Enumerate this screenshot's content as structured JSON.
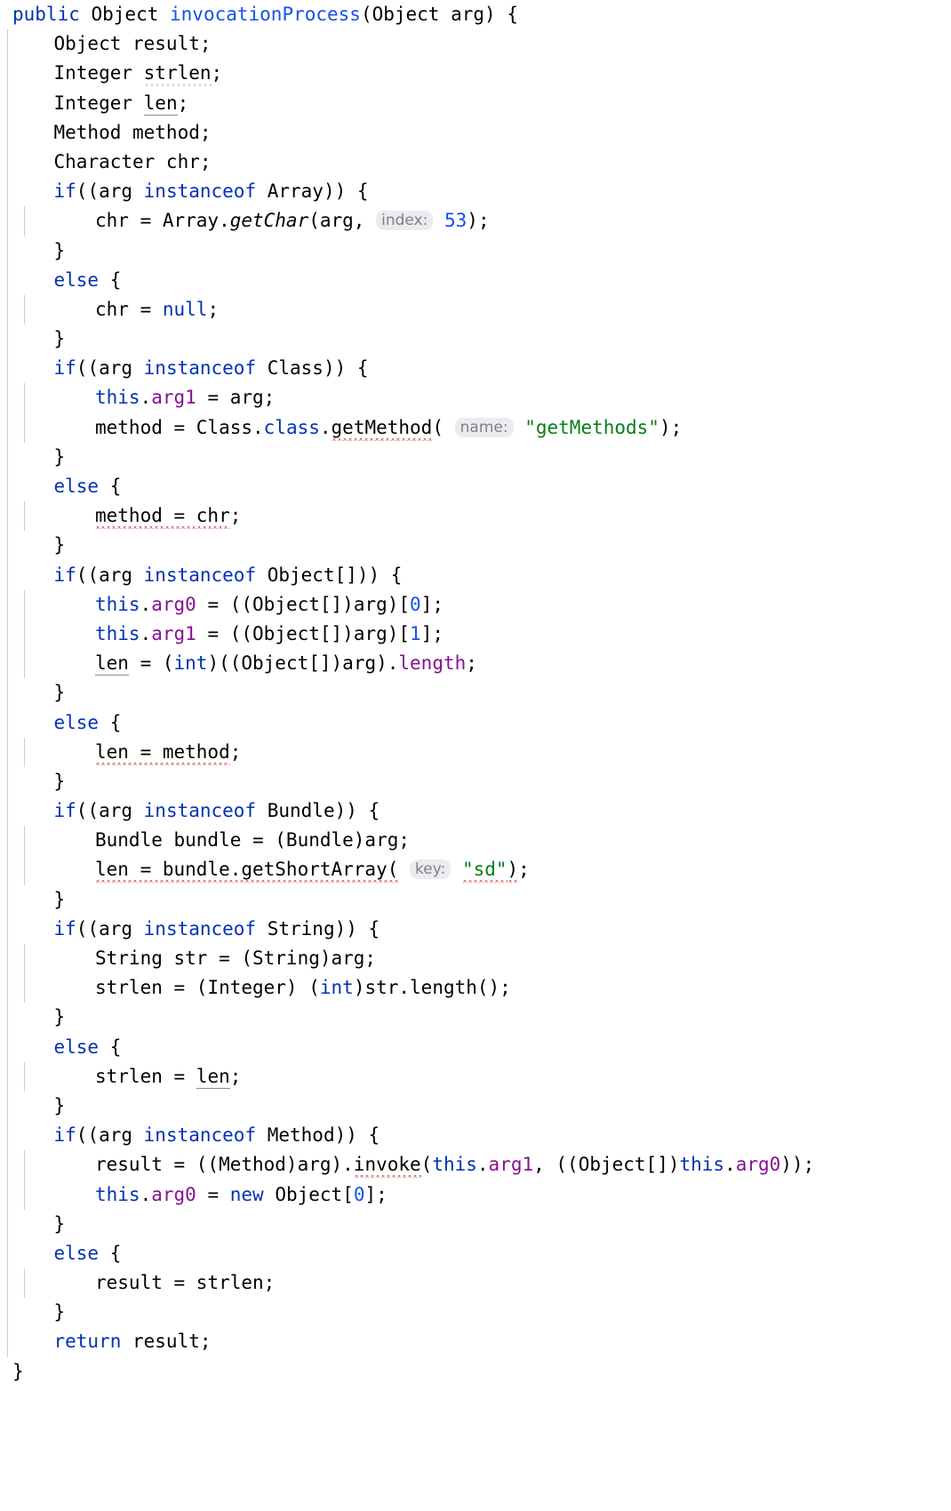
{
  "editor": {
    "language": "java",
    "font_size_px": 21,
    "background": "#ffffff",
    "colors": {
      "keyword": "#0033b3",
      "string": "#067d17",
      "number": "#1750eb",
      "field": "#871094",
      "plain_text": "#000000",
      "inlay_hint_text": "#808080",
      "inlay_hint_background": "#ebecf0",
      "error_squiggle": "#e05252",
      "warning_squiggle": "#9aab7a",
      "gray_underline": "#8a8a8a",
      "indent_guide": "#cfcfcf"
    },
    "method_signature": "public Object invocationProcess(Object arg)",
    "lines": [
      {
        "n": 1,
        "indent": 0,
        "guides": [],
        "tokens": [
          {
            "t": "public",
            "c": "kw"
          },
          {
            "t": " Object ",
            "c": "plain"
          },
          {
            "t": "invocationProcess",
            "c": "ident-blue"
          },
          {
            "t": "(Object arg) {",
            "c": "plain"
          }
        ]
      },
      {
        "n": 2,
        "indent": 1,
        "guides": [
          "g0"
        ],
        "tokens": [
          {
            "t": "Object result;",
            "c": "plain"
          }
        ]
      },
      {
        "n": 3,
        "indent": 1,
        "guides": [
          "g0"
        ],
        "tokens": [
          {
            "t": "Integer ",
            "c": "plain"
          },
          {
            "t": "strlen",
            "c": "plain",
            "d": "warn-squig"
          },
          {
            "t": ";",
            "c": "plain"
          }
        ]
      },
      {
        "n": 4,
        "indent": 1,
        "guides": [
          "g0"
        ],
        "tokens": [
          {
            "t": "Integer ",
            "c": "plain"
          },
          {
            "t": "len",
            "c": "plain",
            "d": "gray-ul"
          },
          {
            "t": ";",
            "c": "plain"
          }
        ]
      },
      {
        "n": 5,
        "indent": 1,
        "guides": [
          "g0"
        ],
        "tokens": [
          {
            "t": "Method method;",
            "c": "plain"
          }
        ]
      },
      {
        "n": 6,
        "indent": 1,
        "guides": [
          "g0"
        ],
        "tokens": [
          {
            "t": "Character chr;",
            "c": "plain"
          }
        ]
      },
      {
        "n": 7,
        "indent": 1,
        "guides": [
          "g0"
        ],
        "tokens": [
          {
            "t": "if",
            "c": "kw"
          },
          {
            "t": "((arg ",
            "c": "plain"
          },
          {
            "t": "instanceof",
            "c": "kw"
          },
          {
            "t": " Array)) {",
            "c": "plain"
          }
        ]
      },
      {
        "n": 8,
        "indent": 2,
        "guides": [
          "g0",
          "g1"
        ],
        "tokens": [
          {
            "t": "chr = Array.",
            "c": "plain"
          },
          {
            "t": "getChar",
            "c": "mi"
          },
          {
            "t": "(arg, ",
            "c": "plain"
          },
          {
            "t": "index:",
            "c": "hint"
          },
          {
            "t": " ",
            "c": "plain"
          },
          {
            "t": "53",
            "c": "num"
          },
          {
            "t": ");",
            "c": "plain"
          }
        ]
      },
      {
        "n": 9,
        "indent": 1,
        "guides": [
          "g0"
        ],
        "tokens": [
          {
            "t": "}",
            "c": "plain"
          }
        ]
      },
      {
        "n": 10,
        "indent": 1,
        "guides": [
          "g0"
        ],
        "tokens": [
          {
            "t": "else",
            "c": "kw"
          },
          {
            "t": " {",
            "c": "plain"
          }
        ]
      },
      {
        "n": 11,
        "indent": 2,
        "guides": [
          "g0",
          "g1"
        ],
        "tokens": [
          {
            "t": "chr = ",
            "c": "plain"
          },
          {
            "t": "null",
            "c": "kw"
          },
          {
            "t": ";",
            "c": "plain"
          }
        ]
      },
      {
        "n": 12,
        "indent": 1,
        "guides": [
          "g0"
        ],
        "tokens": [
          {
            "t": "}",
            "c": "plain"
          }
        ]
      },
      {
        "n": 13,
        "indent": 1,
        "guides": [
          "g0"
        ],
        "tokens": [
          {
            "t": "if",
            "c": "kw"
          },
          {
            "t": "((arg ",
            "c": "plain"
          },
          {
            "t": "instanceof",
            "c": "kw"
          },
          {
            "t": " Class)) {",
            "c": "plain"
          }
        ]
      },
      {
        "n": 14,
        "indent": 2,
        "guides": [
          "g0",
          "g1"
        ],
        "tokens": [
          {
            "t": "this",
            "c": "kw"
          },
          {
            "t": ".",
            "c": "plain"
          },
          {
            "t": "arg1",
            "c": "fld"
          },
          {
            "t": " = arg;",
            "c": "plain"
          }
        ]
      },
      {
        "n": 15,
        "indent": 2,
        "guides": [
          "g0",
          "g1"
        ],
        "tokens": [
          {
            "t": "method = Class.",
            "c": "plain"
          },
          {
            "t": "class",
            "c": "kw"
          },
          {
            "t": ".",
            "c": "plain"
          },
          {
            "t": "getMethod",
            "c": "plain",
            "d": "err-squig"
          },
          {
            "t": "( ",
            "c": "plain"
          },
          {
            "t": "name:",
            "c": "hint"
          },
          {
            "t": " ",
            "c": "plain"
          },
          {
            "t": "\"getMethods\"",
            "c": "str"
          },
          {
            "t": ");",
            "c": "plain"
          }
        ]
      },
      {
        "n": 16,
        "indent": 1,
        "guides": [
          "g0"
        ],
        "tokens": [
          {
            "t": "}",
            "c": "plain"
          }
        ]
      },
      {
        "n": 17,
        "indent": 1,
        "guides": [
          "g0"
        ],
        "tokens": [
          {
            "t": "else",
            "c": "kw"
          },
          {
            "t": " {",
            "c": "plain"
          }
        ]
      },
      {
        "n": 18,
        "indent": 2,
        "guides": [
          "g0",
          "g1"
        ],
        "tokens": [
          {
            "t": "method = chr",
            "c": "plain",
            "d": "err-squig"
          },
          {
            "t": ";",
            "c": "plain"
          }
        ]
      },
      {
        "n": 19,
        "indent": 1,
        "guides": [
          "g0"
        ],
        "tokens": [
          {
            "t": "}",
            "c": "plain"
          }
        ]
      },
      {
        "n": 20,
        "indent": 1,
        "guides": [
          "g0"
        ],
        "tokens": [
          {
            "t": "if",
            "c": "kw"
          },
          {
            "t": "((arg ",
            "c": "plain"
          },
          {
            "t": "instanceof",
            "c": "kw"
          },
          {
            "t": " Object[])) {",
            "c": "plain"
          }
        ]
      },
      {
        "n": 21,
        "indent": 2,
        "guides": [
          "g0",
          "g1"
        ],
        "tokens": [
          {
            "t": "this",
            "c": "kw"
          },
          {
            "t": ".",
            "c": "plain"
          },
          {
            "t": "arg0",
            "c": "fld"
          },
          {
            "t": " = ((Object[])arg)[",
            "c": "plain"
          },
          {
            "t": "0",
            "c": "num"
          },
          {
            "t": "];",
            "c": "plain"
          }
        ]
      },
      {
        "n": 22,
        "indent": 2,
        "guides": [
          "g0",
          "g1"
        ],
        "tokens": [
          {
            "t": "this",
            "c": "kw"
          },
          {
            "t": ".",
            "c": "plain"
          },
          {
            "t": "arg1",
            "c": "fld"
          },
          {
            "t": " = ((Object[])arg)[",
            "c": "plain"
          },
          {
            "t": "1",
            "c": "num"
          },
          {
            "t": "];",
            "c": "plain"
          }
        ]
      },
      {
        "n": 23,
        "indent": 2,
        "guides": [
          "g0",
          "g1"
        ],
        "tokens": [
          {
            "t": "len",
            "c": "plain",
            "d": "gray-ul"
          },
          {
            "t": " = (",
            "c": "plain"
          },
          {
            "t": "int",
            "c": "kw"
          },
          {
            "t": ")((Object[])arg).",
            "c": "plain"
          },
          {
            "t": "length",
            "c": "fld"
          },
          {
            "t": ";",
            "c": "plain"
          }
        ]
      },
      {
        "n": 24,
        "indent": 1,
        "guides": [
          "g0"
        ],
        "tokens": [
          {
            "t": "}",
            "c": "plain"
          }
        ]
      },
      {
        "n": 25,
        "indent": 1,
        "guides": [
          "g0"
        ],
        "tokens": [
          {
            "t": "else",
            "c": "kw"
          },
          {
            "t": " {",
            "c": "plain"
          }
        ]
      },
      {
        "n": 26,
        "indent": 2,
        "guides": [
          "g0",
          "g1"
        ],
        "tokens": [
          {
            "t": "len = method",
            "c": "plain",
            "d": "err-squig"
          },
          {
            "t": ";",
            "c": "plain"
          }
        ]
      },
      {
        "n": 27,
        "indent": 1,
        "guides": [
          "g0"
        ],
        "tokens": [
          {
            "t": "}",
            "c": "plain"
          }
        ]
      },
      {
        "n": 28,
        "indent": 1,
        "guides": [
          "g0"
        ],
        "tokens": [
          {
            "t": "if",
            "c": "kw"
          },
          {
            "t": "((arg ",
            "c": "plain"
          },
          {
            "t": "instanceof",
            "c": "kw"
          },
          {
            "t": " Bundle)) {",
            "c": "plain"
          }
        ]
      },
      {
        "n": 29,
        "indent": 2,
        "guides": [
          "g0",
          "g1"
        ],
        "tokens": [
          {
            "t": "Bundle bundle = (Bundle)arg;",
            "c": "plain"
          }
        ]
      },
      {
        "n": 30,
        "indent": 2,
        "guides": [
          "g0",
          "g1"
        ],
        "tokens": [
          {
            "t": "len = bundle.getShortArray(",
            "c": "plain",
            "d": "err-squig"
          },
          {
            "t": " ",
            "c": "plain"
          },
          {
            "t": "key:",
            "c": "hint"
          },
          {
            "t": " ",
            "c": "plain"
          },
          {
            "t": "\"sd\"",
            "c": "str",
            "d": "err-squig"
          },
          {
            "t": ")",
            "c": "plain",
            "d": "err-squig"
          },
          {
            "t": ";",
            "c": "plain"
          }
        ]
      },
      {
        "n": 31,
        "indent": 1,
        "guides": [
          "g0"
        ],
        "tokens": [
          {
            "t": "}",
            "c": "plain"
          }
        ]
      },
      {
        "n": 32,
        "indent": 1,
        "guides": [
          "g0"
        ],
        "tokens": [
          {
            "t": "if",
            "c": "kw"
          },
          {
            "t": "((arg ",
            "c": "plain"
          },
          {
            "t": "instanceof",
            "c": "kw"
          },
          {
            "t": " String)) {",
            "c": "plain"
          }
        ]
      },
      {
        "n": 33,
        "indent": 2,
        "guides": [
          "g0",
          "g1"
        ],
        "tokens": [
          {
            "t": "String str = (String)arg;",
            "c": "plain"
          }
        ]
      },
      {
        "n": 34,
        "indent": 2,
        "guides": [
          "g0",
          "g1"
        ],
        "tokens": [
          {
            "t": "strlen = (Integer) (",
            "c": "plain"
          },
          {
            "t": "int",
            "c": "kw"
          },
          {
            "t": ")str.length();",
            "c": "plain"
          }
        ]
      },
      {
        "n": 35,
        "indent": 1,
        "guides": [
          "g0"
        ],
        "tokens": [
          {
            "t": "}",
            "c": "plain"
          }
        ]
      },
      {
        "n": 36,
        "indent": 1,
        "guides": [
          "g0"
        ],
        "tokens": [
          {
            "t": "else",
            "c": "kw"
          },
          {
            "t": " {",
            "c": "plain"
          }
        ]
      },
      {
        "n": 37,
        "indent": 2,
        "guides": [
          "g0",
          "g1"
        ],
        "tokens": [
          {
            "t": "strlen = ",
            "c": "plain"
          },
          {
            "t": "len",
            "c": "plain",
            "d": "gray-ul"
          },
          {
            "t": ";",
            "c": "plain"
          }
        ]
      },
      {
        "n": 38,
        "indent": 1,
        "guides": [
          "g0"
        ],
        "tokens": [
          {
            "t": "}",
            "c": "plain"
          }
        ]
      },
      {
        "n": 39,
        "indent": 1,
        "guides": [
          "g0"
        ],
        "tokens": [
          {
            "t": "if",
            "c": "kw"
          },
          {
            "t": "((arg ",
            "c": "plain"
          },
          {
            "t": "instanceof",
            "c": "kw"
          },
          {
            "t": " Method)) {",
            "c": "plain"
          }
        ]
      },
      {
        "n": 40,
        "indent": 2,
        "guides": [
          "g0",
          "g1"
        ],
        "tokens": [
          {
            "t": "result = ((Method)arg).",
            "c": "plain"
          },
          {
            "t": "invoke",
            "c": "plain",
            "d": "err-squig"
          },
          {
            "t": "(",
            "c": "plain"
          },
          {
            "t": "this",
            "c": "kw"
          },
          {
            "t": ".",
            "c": "plain"
          },
          {
            "t": "arg1",
            "c": "fld"
          },
          {
            "t": ", ((Object[])",
            "c": "plain"
          },
          {
            "t": "this",
            "c": "kw"
          },
          {
            "t": ".",
            "c": "plain"
          },
          {
            "t": "arg0",
            "c": "fld"
          },
          {
            "t": "));",
            "c": "plain"
          }
        ]
      },
      {
        "n": 41,
        "indent": 2,
        "guides": [
          "g0",
          "g1"
        ],
        "tokens": [
          {
            "t": "this",
            "c": "kw"
          },
          {
            "t": ".",
            "c": "plain"
          },
          {
            "t": "arg0",
            "c": "fld"
          },
          {
            "t": " = ",
            "c": "plain"
          },
          {
            "t": "new",
            "c": "kw"
          },
          {
            "t": " Object[",
            "c": "plain"
          },
          {
            "t": "0",
            "c": "num"
          },
          {
            "t": "];",
            "c": "plain"
          }
        ]
      },
      {
        "n": 42,
        "indent": 1,
        "guides": [
          "g0"
        ],
        "tokens": [
          {
            "t": "}",
            "c": "plain"
          }
        ]
      },
      {
        "n": 43,
        "indent": 1,
        "guides": [
          "g0"
        ],
        "tokens": [
          {
            "t": "else",
            "c": "kw"
          },
          {
            "t": " {",
            "c": "plain"
          }
        ]
      },
      {
        "n": 44,
        "indent": 2,
        "guides": [
          "g0",
          "g1"
        ],
        "tokens": [
          {
            "t": "result = strlen;",
            "c": "plain"
          }
        ]
      },
      {
        "n": 45,
        "indent": 1,
        "guides": [
          "g0"
        ],
        "tokens": [
          {
            "t": "}",
            "c": "plain"
          }
        ]
      },
      {
        "n": 46,
        "indent": 1,
        "guides": [
          "g0"
        ],
        "tokens": [
          {
            "t": "return",
            "c": "kw"
          },
          {
            "t": " result;",
            "c": "plain"
          }
        ]
      },
      {
        "n": 47,
        "indent": 0,
        "guides": [],
        "tokens": [
          {
            "t": "}",
            "c": "plain"
          }
        ]
      }
    ]
  }
}
